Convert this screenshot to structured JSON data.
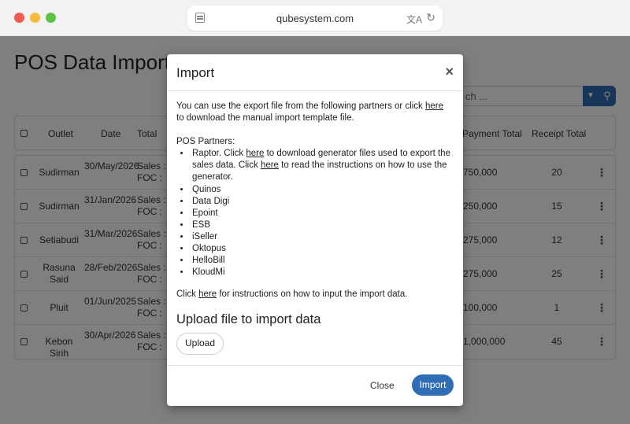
{
  "browser": {
    "url": "qubesystem.com",
    "icons": [
      "sidebar-icon",
      "translate-icon",
      "reload-icon"
    ]
  },
  "page": {
    "title": "POS Data Import",
    "search_placeholder": "ch ...",
    "table": {
      "headers": [
        "Outlet",
        "Date",
        "Total",
        "Payment Total",
        "Receipt Total"
      ],
      "rows": [
        {
          "outlet": "Sudirman",
          "date": "30/May/2026",
          "total_l1": "Sales  :",
          "total_l2": "FOC  :",
          "payment": "750,000",
          "receipts": "20"
        },
        {
          "outlet": "Sudirman",
          "date": "31/Jan/2026",
          "total_l1": "Sales  :",
          "total_l2": "FOC  :",
          "payment": "250,000",
          "receipts": "15"
        },
        {
          "outlet": "Setiabudi",
          "date": "31/Mar/2026",
          "total_l1": "Sales  :",
          "total_l2": "FOC  :",
          "payment": "275,000",
          "receipts": "12"
        },
        {
          "outlet": "Rasuna Said",
          "date": "28/Feb/2026",
          "total_l1": "Sales  :",
          "total_l2": "FOC  :",
          "payment": "275,000",
          "receipts": "25"
        },
        {
          "outlet": "Pluit",
          "date": "01/Jun/2025",
          "total_l1": "Sales  :",
          "total_l2": "FOC  :",
          "payment": "100,000",
          "receipts": "1"
        },
        {
          "outlet": "Kebon Sirih",
          "date": "30/Apr/2026",
          "total_l1": "Sales  :",
          "total_l2": "FOC  :",
          "payment": "1,000,000",
          "receipts": "45"
        }
      ]
    }
  },
  "modal": {
    "title": "Import",
    "close_glyph": "×",
    "intro_pre": "You can use the export file from the following partners or click ",
    "here": "here",
    "intro_post": " to download the manual import template file.",
    "partners_title": "POS Partners:",
    "raptor_pre": "Raptor. Click ",
    "raptor_mid": " to download generator files used to export the sales data. Click ",
    "raptor_post": " to read the instructions on how to use the generator.",
    "partners": [
      "Quinos",
      "Data Digi",
      "Epoint",
      "ESB",
      "iSeller",
      "Oktopus",
      "HelloBill",
      "KloudMi"
    ],
    "instr_pre": "Click ",
    "instr_post": " for instructions on how to input the import data.",
    "upload_title": "Upload file to import data",
    "upload_label": "Upload",
    "close_label": "Close",
    "import_label": "Import"
  },
  "colors": {
    "accent": "#2f6db5",
    "overlay": "rgba(0,0,0,0.5)"
  }
}
